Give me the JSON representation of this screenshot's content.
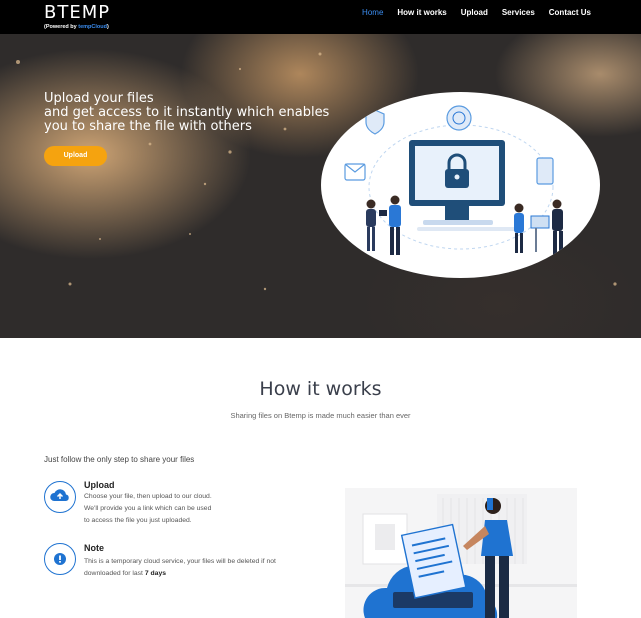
{
  "brand": {
    "name": "BTEMP",
    "powered_prefix": "(Powered by ",
    "powered_accent": "tempCloud",
    "powered_suffix": ")"
  },
  "nav": {
    "items": [
      "Home",
      "How it works",
      "Upload",
      "Services",
      "Contact Us"
    ],
    "active": "Home"
  },
  "hero": {
    "line1": "Upload your files",
    "line2": "and get access to it instantly which enables",
    "line3": "you to share the file with others",
    "button_label": "Upload"
  },
  "how_it_works": {
    "title": "How it works",
    "subtitle": "Sharing files on Btemp is made much easier than ever",
    "intro": "Just follow the only step to share your files",
    "features": [
      {
        "title": "Upload",
        "lines": [
          "Choose your file, then upload to our cloud.",
          "We'll provide you a link which can be used",
          "to access the file you just uploaded."
        ],
        "icon": "cloud-upload-icon"
      },
      {
        "title": "Note",
        "line1": "This is a temporary cloud service, your files will be deleted if not",
        "line2_prefix": "downloaded for last ",
        "line2_bold": "7 days",
        "icon": "info-icon"
      }
    ]
  },
  "colors": {
    "accent_blue": "#1f73d1",
    "button_orange": "#f5a30f",
    "nav_bg": "#000000"
  }
}
